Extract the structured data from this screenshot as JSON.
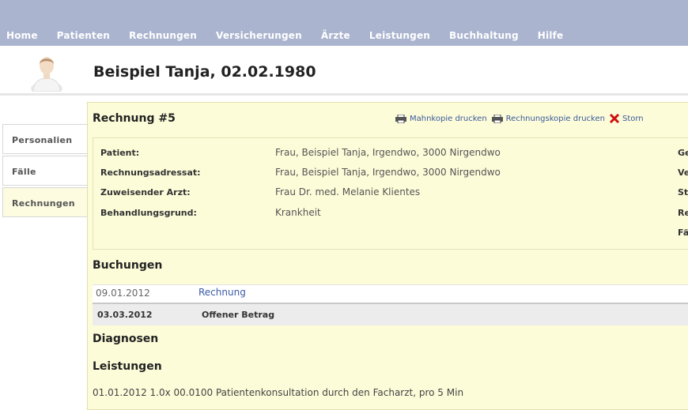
{
  "nav": [
    "Home",
    "Patienten",
    "Rechnungen",
    "Versicherungen",
    "Ärzte",
    "Leistungen",
    "Buchhaltung",
    "Hilfe"
  ],
  "patient": {
    "title": "Beispiel Tanja, 02.02.1980"
  },
  "sidetabs": [
    "Personalien",
    "Fälle",
    "Rechnungen"
  ],
  "invoice": {
    "title": "Rechnung #5",
    "actions": [
      "Mahnkopie drucken",
      "Rechnungskopie drucken",
      "Storn"
    ],
    "details": [
      {
        "label": "Patient:",
        "value": "Frau, Beispiel Tanja, Irgendwo, 3000 Nirgendwo"
      },
      {
        "label": "Rechnungsadressat:",
        "value": "Frau, Beispiel Tanja, Irgendwo, 3000 Nirgendwo"
      },
      {
        "label": "Zuweisender Arzt:",
        "value": "Frau Dr. med. Melanie Klientes"
      },
      {
        "label": "Behandlungsgrund:",
        "value": "Krankheit"
      }
    ],
    "right_labels": [
      "Ge",
      "Ve",
      "St",
      "Re",
      "Fä"
    ]
  },
  "sections": {
    "buchungen": "Buchungen",
    "diagnosen": "Diagnosen",
    "leistungen": "Leistungen"
  },
  "buchungen": [
    {
      "date": "09.01.2012",
      "text": "Rechnung"
    },
    {
      "date": "03.03.2012",
      "text": "Offener Betrag"
    }
  ],
  "leistungen_row": "01.01.2012  1.0x 00.0100   Patientenkonsultation durch den Facharzt, pro 5 Min",
  "colors": {
    "topbar": "#aab4cf",
    "panel": "#fdfcd9",
    "link": "#3a5ca8",
    "storno": "#cc1111"
  }
}
